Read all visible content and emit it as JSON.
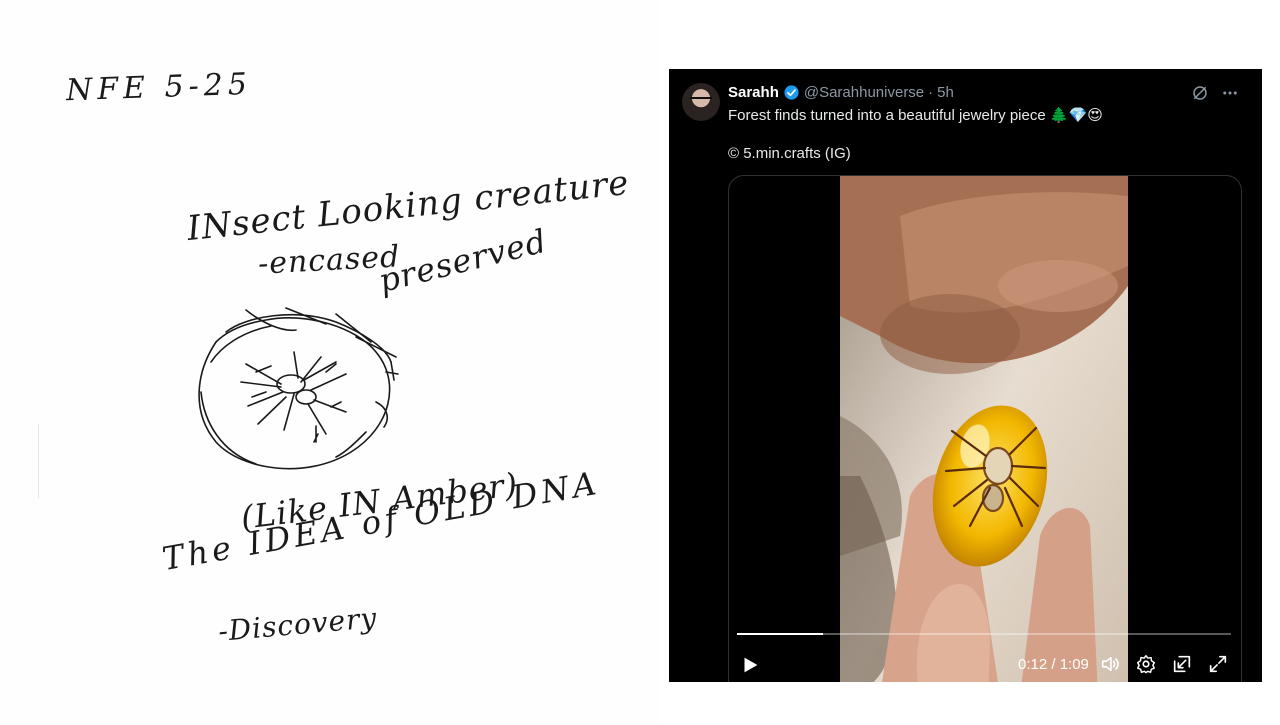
{
  "note": {
    "title": "NFE 5-25",
    "line1": "INsect Looking creature",
    "line2": "-encased",
    "line3": "preserved",
    "line4": "(Like IN Amber)",
    "line5": "The IDEA of OLD DNA",
    "line6": "-Discovery"
  },
  "tweet": {
    "author_name": "Sarahh",
    "author_handle": "@Sarahhuniverse",
    "separator": "·",
    "time_ago": "5h",
    "text": "Forest finds turned into a beautiful jewelry piece",
    "emojis": "🌲💎😍",
    "credit": "© 5.min.crafts (IG)",
    "colors": {
      "background": "#000000",
      "text": "#e7e9ea",
      "secondary": "#8b98a5",
      "verified": "#1d9bf0",
      "border": "#2f3336"
    },
    "icons": [
      "avatar",
      "verified-badge-icon",
      "grok-icon",
      "more-icon"
    ]
  },
  "video": {
    "time_display": "0:12 / 1:09",
    "progress": 0.174,
    "icons": [
      "play-icon",
      "volume-icon",
      "settings-icon",
      "dock-icon",
      "fullscreen-icon"
    ]
  }
}
